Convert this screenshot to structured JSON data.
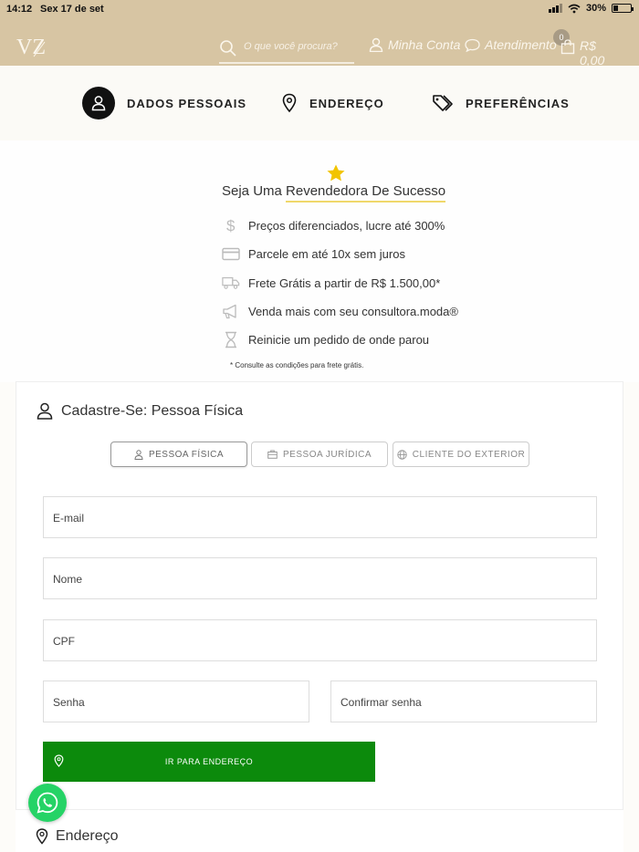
{
  "status_bar": {
    "time": "14:12",
    "date": "Sex 17 de set",
    "battery": "30%",
    "battery_level": 0.3
  },
  "header": {
    "logo_text": "VZ",
    "search_placeholder": "O que você procura?",
    "account_label": "Minha Conta",
    "support_label": "Atendimento",
    "cart_count": "0",
    "cart_total": "R$ 0,00",
    "colors": {
      "header_bg": "#d7c5a3",
      "header_text": "#fbf6ec"
    }
  },
  "steps": [
    {
      "label": "DADOS PESSOAIS",
      "icon": "user-icon",
      "active": true
    },
    {
      "label": "ENDEREÇO",
      "icon": "location-pin-icon",
      "active": false
    },
    {
      "label": "PREFERÊNCIAS",
      "icon": "tags-icon",
      "active": false
    }
  ],
  "promo": {
    "title_prefix": "Seja Uma ",
    "title_highlight": "Revendedora De Sucesso",
    "star_icon": "star-icon",
    "benefits": [
      {
        "icon": "dollar-icon",
        "text": "Preços diferenciados, lucre até 300%"
      },
      {
        "icon": "credit-card-icon",
        "text": "Parcele em até 10x sem juros"
      },
      {
        "icon": "truck-icon",
        "text": "Frete Grátis a partir de R$ 1.500,00*"
      },
      {
        "icon": "megaphone-icon",
        "text": "Venda mais com seu consultora.moda®"
      },
      {
        "icon": "hourglass-icon",
        "text": "Reinicie um pedido de onde parou"
      }
    ],
    "note": "* Consulte as condições para frete grátis.",
    "colors": {
      "star": "#f2c400",
      "underline": "#f0d86b"
    }
  },
  "form": {
    "title": "Cadastre-Se: Pessoa Física",
    "tabs": [
      {
        "label": "PESSOA FÍSICA",
        "icon": "user-icon",
        "active": true
      },
      {
        "label": "PESSOA JURÍDICA",
        "icon": "briefcase-icon",
        "active": false
      },
      {
        "label": "CLIENTE DO EXTERIOR",
        "icon": "globe-icon",
        "active": false
      }
    ],
    "fields": {
      "email": "E-mail",
      "name": "Nome",
      "cpf": "CPF",
      "password": "Senha",
      "confirm_password": "Confirmar senha"
    },
    "submit_label": "IR PARA ENDEREÇO",
    "colors": {
      "submit_bg": "#0c8a0c"
    }
  },
  "address_section": {
    "title": "Endereço"
  },
  "whatsapp": {
    "icon": "whatsapp-icon",
    "color": "#25d366"
  }
}
